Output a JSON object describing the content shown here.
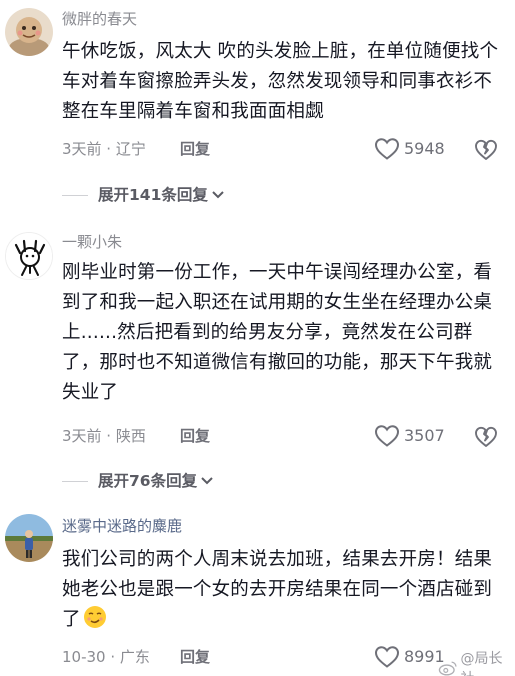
{
  "comments": [
    {
      "username": "微胖的春天",
      "text": "午休吃饭，风太大 吹的头发脸上脏，在单位随便找个车对着车窗擦脸弄头发，忽然发现领导和同事衣衫不整在车里隔着车窗和我面面相觑",
      "meta": "3天前 · 辽宁",
      "reply_label": "回复",
      "likes": "5948",
      "expand_label": "展开141条回复"
    },
    {
      "username": "一颗小朱",
      "text": "刚毕业时第一份工作，一天中午误闯经理办公室，看到了和我一起入职还在试用期的女生坐在经理办公桌上......然后把看到的给男友分享，竟然发在公司群了，那时也不知道微信有撤回的功能，那天下午我就失业了",
      "meta": "3天前 · 陕西",
      "reply_label": "回复",
      "likes": "3507",
      "expand_label": "展开76条回复"
    },
    {
      "username": "迷雾中迷路的麋鹿",
      "text": "我们公司的两个人周末说去加班，结果去开房！结果她老公也是跟一个女的去开房结果在同一个酒店碰到了",
      "meta": "10-30 · 广东",
      "reply_label": "回复",
      "likes": "8991"
    }
  ],
  "watermark": "@局长社",
  "colors": {
    "text": "#161823",
    "secondary": "#8a8b91",
    "divider": "#d0d1d5"
  },
  "icons": [
    "heart-outline-icon",
    "broken-heart-icon",
    "chevron-down-icon",
    "smirk-emoji-icon",
    "weibo-icon"
  ]
}
